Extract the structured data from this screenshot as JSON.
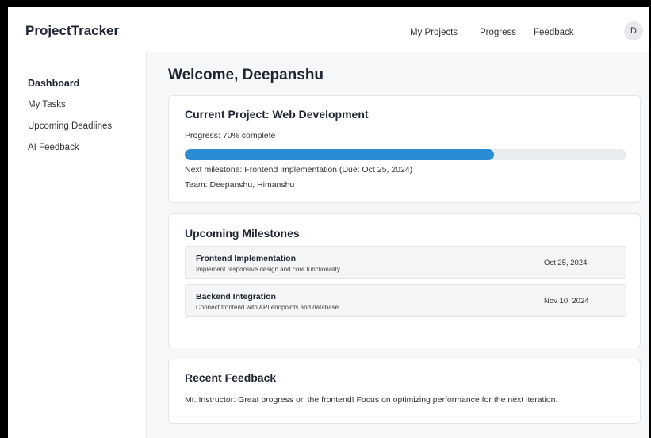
{
  "header": {
    "brand": "ProjectTracker",
    "nav": [
      "My Projects",
      "Progress",
      "Feedback"
    ],
    "avatar_initial": "D"
  },
  "sidebar": {
    "items": [
      "Dashboard",
      "My Tasks",
      "Upcoming Deadlines",
      "AI Feedback"
    ]
  },
  "main": {
    "welcome": "Welcome, Deepanshu",
    "current_project": {
      "title": "Current Project: Web Development",
      "progress_text": "Progress: 70% complete",
      "progress_value": 0.7,
      "next_milestone": "Next milestone: Frontend Implementation (Due: Oct 25, 2024)",
      "team": "Team: Deepanshu, Himanshu"
    },
    "milestones": {
      "title": "Upcoming Milestones",
      "items": [
        {
          "title": "Frontend Implementation",
          "description": "Implement responsive design and core functionality",
          "date": "Oct 25, 2024"
        },
        {
          "title": "Backend Integration",
          "description": "Connect frontend with API endpoints and database",
          "date": "Nov 10, 2024"
        }
      ]
    },
    "feedback": {
      "title": "Recent Feedback",
      "text": "Mr. Instructor: Great progress on the frontend! Focus on optimizing performance for the next iteration."
    }
  },
  "colors": {
    "accent": "#2b8cd6",
    "page_background": "#f6f7f9",
    "outer_border": "#000000"
  }
}
